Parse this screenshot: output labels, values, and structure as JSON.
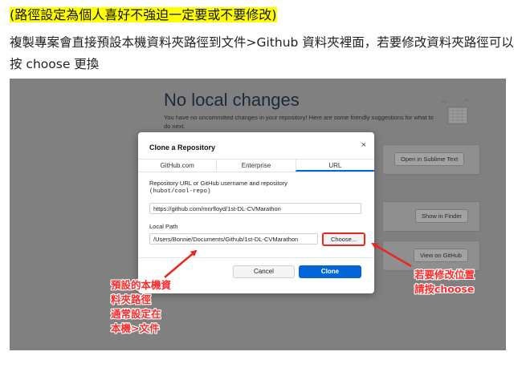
{
  "doc": {
    "note": "(路徑設定為個人喜好不強迫一定要或不要修改)",
    "paragraph": "複製專案會直接預設本機資料夾路徑到文件>Github 資料夾裡面，若要修改資料夾路徑可以按 choose 更換"
  },
  "background": {
    "title": "No local changes",
    "subtitle": "You have no uncommitted changes in your repository! Here are some friendly suggestions for what to do next.",
    "buttons": [
      "Open in Sublime Text",
      "Show in Finder",
      "View on GitHub"
    ]
  },
  "modal": {
    "title": "Clone a Repository",
    "close_glyph": "×",
    "tabs": [
      "GitHub.com",
      "Enterprise",
      "URL"
    ],
    "active_tab": "URL",
    "url_label": "Repository URL or GitHub username and repository",
    "url_hint": "(hubot/cool-repo)",
    "url_value": "https://github.com/mnrfloyd/1st-DL-CVMarathon",
    "path_label": "Local Path",
    "path_value": "/Users/Bonnie/Documents/Github/1st-DL-CVMarathon",
    "choose_label": "Choose...",
    "cancel_label": "Cancel",
    "clone_label": "Clone"
  },
  "annotations": {
    "left": [
      "預設的本機資",
      "料夾路徑",
      "通常設定在",
      "本機>文件"
    ],
    "right": [
      "若要修改位置",
      "請按choose"
    ]
  },
  "colors": {
    "annotation_red": "#ff2a2a",
    "highlight_yellow": "#ffff00",
    "primary_blue": "#0366d6",
    "screenshot_gray": "#808080"
  }
}
